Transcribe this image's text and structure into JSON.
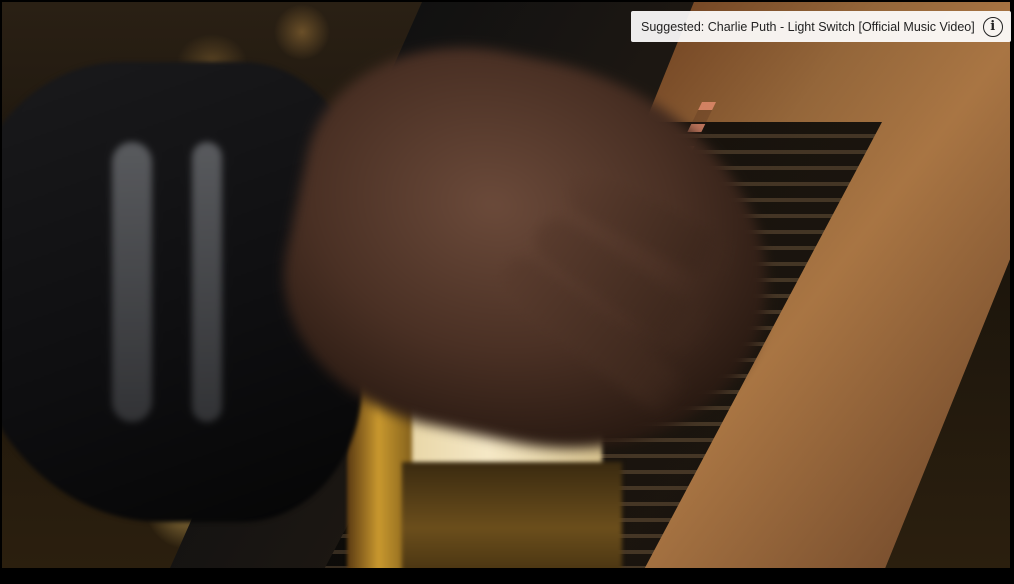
{
  "suggestion": {
    "text": "Suggested: Charlie Puth - Light Switch [Official Music Video]",
    "icon": "info-icon",
    "icon_glyph": "i"
  },
  "colors": {
    "player_background": "#000000",
    "suggestion_background": "#ffffff",
    "suggestion_text": "#222222"
  }
}
